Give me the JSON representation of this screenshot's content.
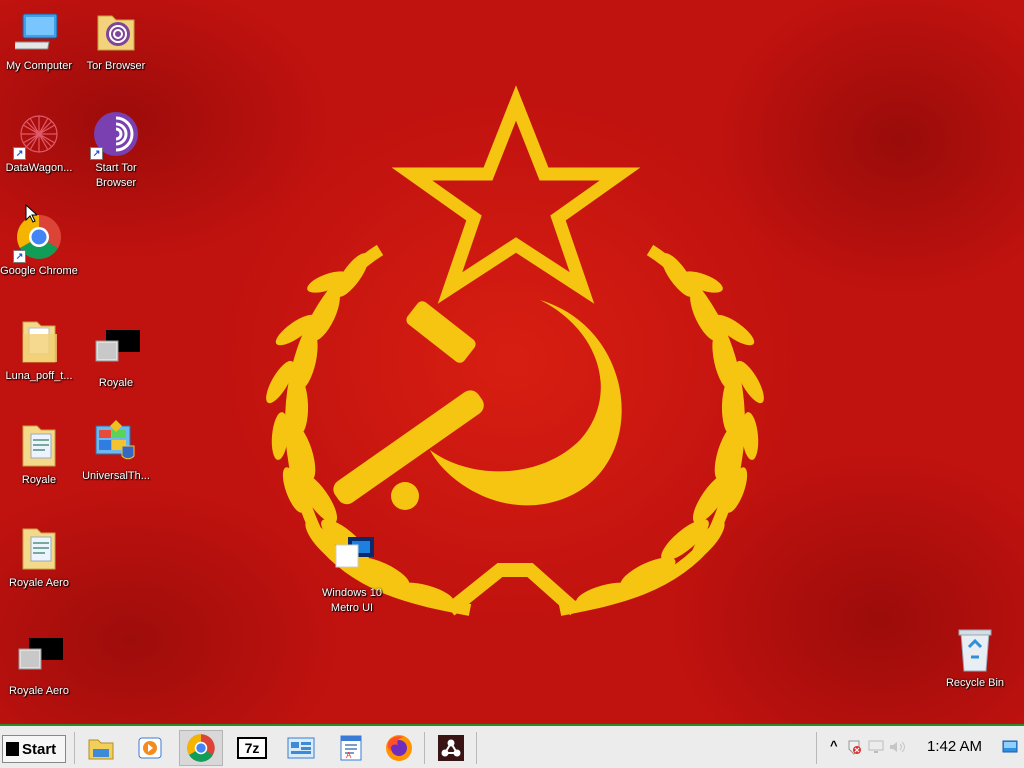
{
  "desktop": {
    "icons": [
      {
        "label": "My Computer",
        "icon": "computer-icon"
      },
      {
        "label": "Tor Browser",
        "icon": "folder-tor-icon"
      },
      {
        "label": "DataWagon...",
        "icon": "datawagon-icon"
      },
      {
        "label": "Start Tor Browser",
        "icon": "tor-onion-icon"
      },
      {
        "label": "Google Chrome",
        "icon": "chrome-icon"
      },
      {
        "label": "Luna_poff_t...",
        "icon": "folder-icon"
      },
      {
        "label": "Royale",
        "icon": "theme-file-icon"
      },
      {
        "label": "Royale",
        "icon": "folder-doc-icon"
      },
      {
        "label": "UniversalTh...",
        "icon": "universal-theme-patcher-icon"
      },
      {
        "label": "Royale Aero",
        "icon": "folder-doc-icon"
      },
      {
        "label": "Windows 10 Metro UI",
        "icon": "theme-file-icon"
      },
      {
        "label": "Royale Aero",
        "icon": "theme-file-icon"
      },
      {
        "label": "Recycle Bin",
        "icon": "recycle-bin-icon"
      }
    ]
  },
  "taskbar": {
    "start_label": "Start",
    "apps": [
      {
        "name": "File Explorer",
        "icon": "explorer-icon"
      },
      {
        "name": "Media Player",
        "icon": "media-player-icon"
      },
      {
        "name": "Google Chrome",
        "icon": "chrome-icon"
      },
      {
        "name": "7-Zip",
        "icon": "7zip-icon",
        "text": "7z"
      },
      {
        "name": "Control Panel",
        "icon": "control-panel-icon"
      },
      {
        "name": "WordPad",
        "icon": "wordpad-icon"
      },
      {
        "name": "Firefox",
        "icon": "firefox-icon"
      },
      {
        "name": "Unknown App",
        "icon": "app-icon"
      }
    ],
    "tray": {
      "clock": "1:42 AM",
      "chevron": "^"
    }
  },
  "colors": {
    "wallpaper_red": "#c0120f",
    "emblem_gold": "#f5c511",
    "taskbar_bg": "#ececec",
    "taskbar_border": "#2b8a2b"
  }
}
